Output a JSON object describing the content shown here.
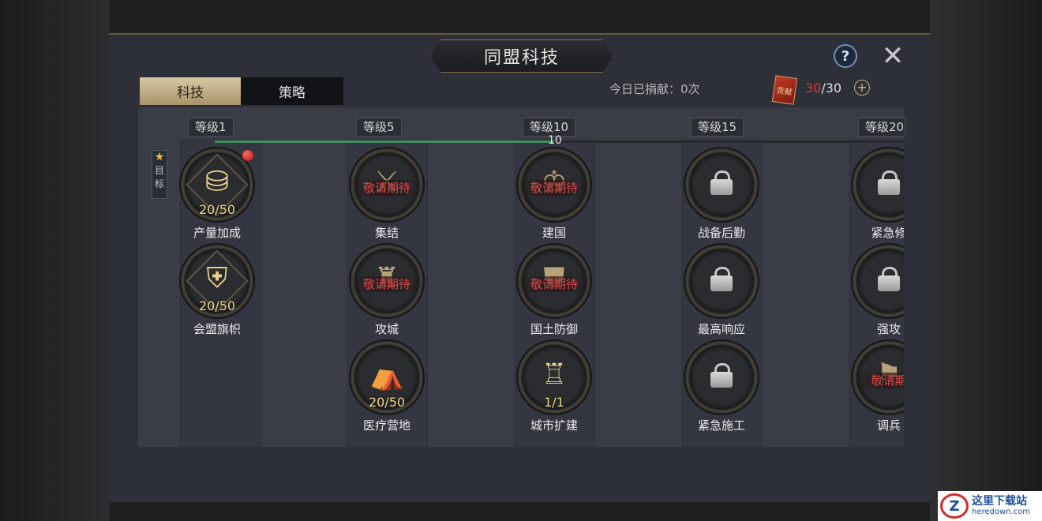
{
  "window": {
    "title": "同盟科技",
    "help_label": "?",
    "close_label": "✕"
  },
  "tabs": [
    {
      "label": "科技",
      "active": true
    },
    {
      "label": "策略",
      "active": false
    }
  ],
  "contribution": {
    "text": "今日已捐献：0次",
    "current": "30",
    "max": "/30",
    "card_label": "贡献",
    "plus_label": "+"
  },
  "target": {
    "star": "★",
    "label1": "目",
    "label2": "标"
  },
  "levels": [
    "等级1",
    "等级5",
    "等级10",
    "等级15",
    "等级20"
  ],
  "progress": {
    "value": 10,
    "label": "10"
  },
  "nodes": [
    {
      "name": "产量加成",
      "level": "20/50",
      "icon": "resource-crates-icon",
      "has_notice": true
    },
    {
      "name": "会盟旗帜",
      "level": "20/50",
      "icon": "eagle-shield-icon"
    },
    {
      "name": "集结",
      "soon": "敬请期待",
      "icon": "crossed-swords-icon"
    },
    {
      "name": "攻城",
      "soon": "敬请期待",
      "icon": "siege-crown-icon"
    },
    {
      "name": "医疗营地",
      "level": "20/50",
      "icon": "medical-tent-icon"
    },
    {
      "name": "建国",
      "soon": "敬请期待",
      "icon": "founding-emblem-icon"
    },
    {
      "name": "国土防御",
      "soon": "敬请期待",
      "icon": "defense-emblem-icon"
    },
    {
      "name": "城市扩建",
      "level": "1/1",
      "icon": "castle-icon"
    },
    {
      "name": "战备后勤",
      "icon": "lock-icon"
    },
    {
      "name": "最高响应",
      "icon": "lock-icon"
    },
    {
      "name": "紧急施工",
      "icon": "lock-icon"
    },
    {
      "name": "紧急修",
      "icon": "lock-icon"
    },
    {
      "name": "强攻",
      "icon": "lock-icon"
    },
    {
      "name": "调兵",
      "soon": "敬请期",
      "icon": "troops-icon"
    }
  ],
  "watermark": {
    "cn": "这里下载站",
    "en": "heredown.com",
    "logo": "Z"
  }
}
